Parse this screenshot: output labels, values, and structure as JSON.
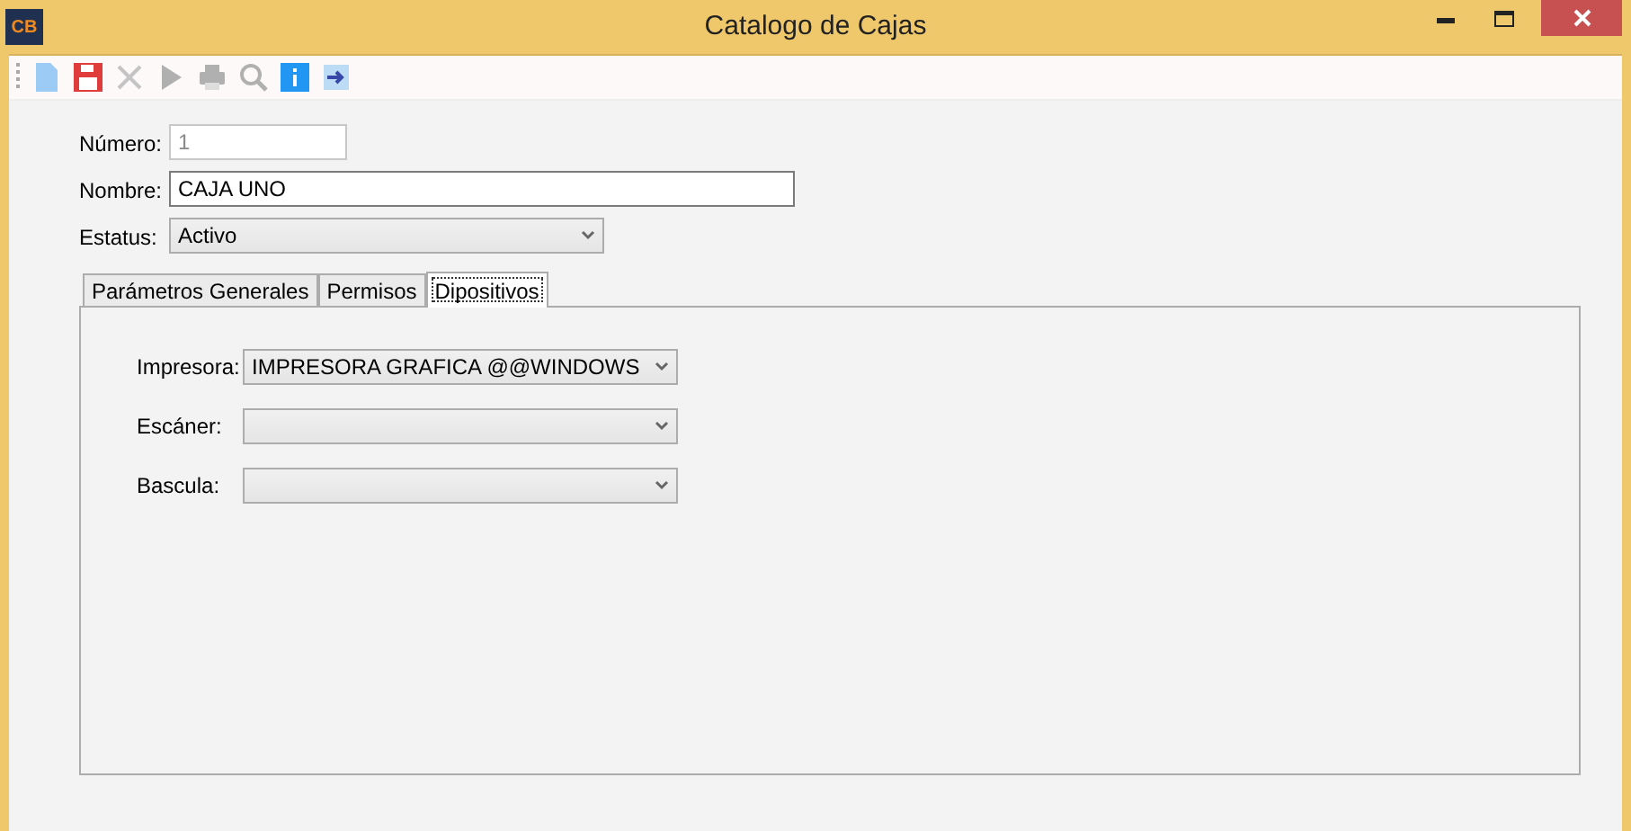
{
  "window": {
    "logo": "CB",
    "title": "Catalogo de Cajas"
  },
  "toolbar": [
    {
      "kind": "new",
      "disabled": false
    },
    {
      "kind": "save",
      "disabled": false
    },
    {
      "kind": "cancel",
      "disabled": true
    },
    {
      "kind": "run",
      "disabled": true
    },
    {
      "kind": "print",
      "disabled": true
    },
    {
      "kind": "search",
      "disabled": true
    },
    {
      "kind": "info",
      "disabled": false
    },
    {
      "kind": "exit",
      "disabled": false
    }
  ],
  "fields": [
    {
      "label": "Número:",
      "kind": "text",
      "value": "1",
      "disabled": true
    },
    {
      "label": "Nombre:",
      "kind": "text",
      "value": "CAJA UNO",
      "disabled": false
    },
    {
      "label": "Estatus:",
      "kind": "select",
      "value": "Activo",
      "disabled": false
    }
  ],
  "tabs": [
    {
      "label": "Parámetros Generales",
      "selected": false
    },
    {
      "label": "Permisos",
      "selected": false
    },
    {
      "label": "Dipositivos",
      "selected": true
    }
  ],
  "devices": [
    {
      "label": "Impresora:",
      "value": "IMPRESORA GRAFICA @@WINDOWS"
    },
    {
      "label": "Escáner:"
    },
    {
      "label": "Bascula:"
    }
  ]
}
